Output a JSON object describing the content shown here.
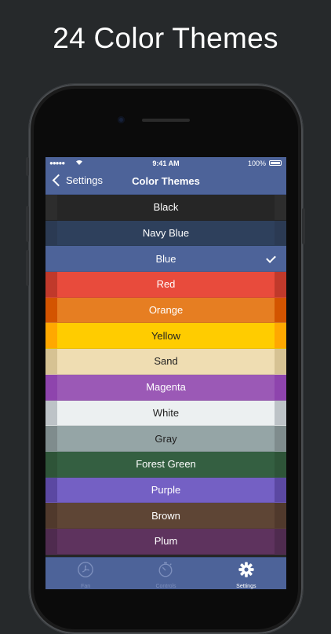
{
  "headline": "24 Color Themes",
  "status_bar": {
    "signal": "●●●●●",
    "time": "9:41 AM",
    "battery": "100%"
  },
  "nav": {
    "back_label": "Settings",
    "title": "Color Themes"
  },
  "themes": [
    {
      "name": "Black",
      "color": "#262626",
      "edge": "#2d2d2d",
      "text": "#ffffff",
      "selected": false
    },
    {
      "name": "Navy Blue",
      "color": "#2e405c",
      "edge": "#2b3a53",
      "text": "#ffffff",
      "selected": false
    },
    {
      "name": "Blue",
      "color": "#4d6399",
      "edge": "#4d6399",
      "text": "#ffffff",
      "selected": true
    },
    {
      "name": "Red",
      "color": "#e84b3c",
      "edge": "#c0392b",
      "text": "#ffffff",
      "selected": false
    },
    {
      "name": "Orange",
      "color": "#e67e22",
      "edge": "#d35400",
      "text": "#ffffff",
      "selected": false
    },
    {
      "name": "Yellow",
      "color": "#ffcc00",
      "edge": "#ffa800",
      "text": "#222222",
      "selected": false
    },
    {
      "name": "Sand",
      "color": "#efddb2",
      "edge": "#d6c293",
      "text": "#222222",
      "selected": false
    },
    {
      "name": "Magenta",
      "color": "#9b59b6",
      "edge": "#8e44ad",
      "text": "#ffffff",
      "selected": false
    },
    {
      "name": "White",
      "color": "#ecf0f1",
      "edge": "#bdc3c7",
      "text": "#222222",
      "selected": false
    },
    {
      "name": "Gray",
      "color": "#95a5a6",
      "edge": "#7f8c8d",
      "text": "#222222",
      "selected": false
    },
    {
      "name": "Forest Green",
      "color": "#345f41",
      "edge": "#2e5438",
      "text": "#ffffff",
      "selected": false
    },
    {
      "name": "Purple",
      "color": "#7460c4",
      "edge": "#5b48a2",
      "text": "#ffffff",
      "selected": false
    },
    {
      "name": "Brown",
      "color": "#5e4535",
      "edge": "#50392c",
      "text": "#ffffff",
      "selected": false
    },
    {
      "name": "Plum",
      "color": "#5e335e",
      "edge": "#4f2b4f",
      "text": "#ffffff",
      "selected": false
    }
  ],
  "tabs": [
    {
      "label": "Fan",
      "icon": "fan-icon",
      "active": false
    },
    {
      "label": "Controls",
      "icon": "stopwatch-icon",
      "active": false
    },
    {
      "label": "Settings",
      "icon": "gear-icon",
      "active": true
    }
  ]
}
